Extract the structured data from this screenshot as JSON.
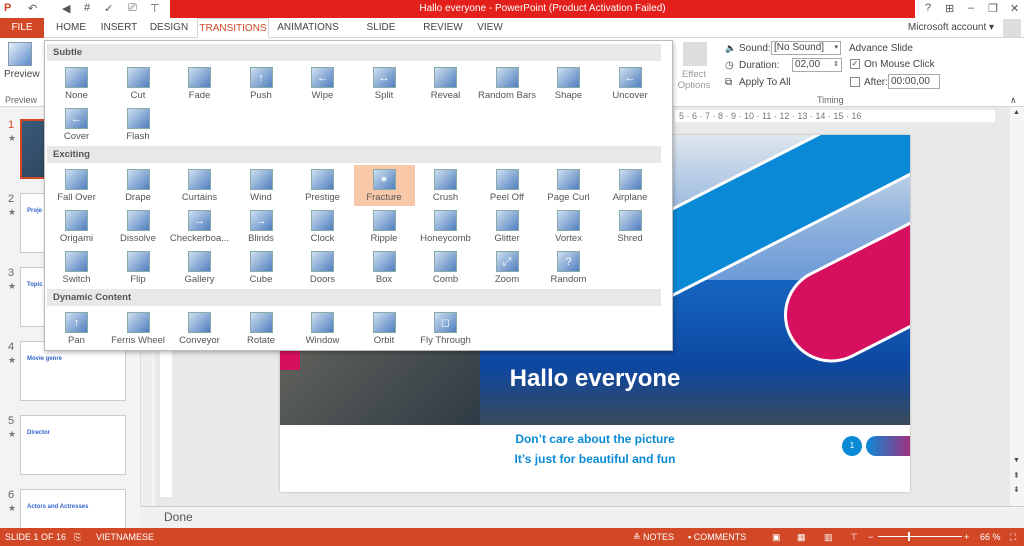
{
  "window": {
    "title": "Hallo everyone -  PowerPoint (Product Activation Failed)",
    "help": "?",
    "account": "Microsoft account"
  },
  "tabs": [
    "FILE",
    "HOME",
    "INSERT",
    "DESIGN",
    "TRANSITIONS",
    "ANIMATIONS",
    "SLIDE SHOW",
    "REVIEW",
    "VIEW"
  ],
  "ribbon": {
    "preview_label": "Preview",
    "preview_group": "Preview",
    "effect_options": "Effect Options",
    "sound_label": "Sound:",
    "sound_value": "[No Sound]",
    "duration_label": "Duration:",
    "duration_value": "02,00",
    "apply_all": "Apply To All",
    "advance_title": "Advance Slide",
    "on_click": "On Mouse Click",
    "on_click_checked": true,
    "after_label": "After:",
    "after_value": "00:00,00",
    "after_checked": false,
    "timing_group": "Timing"
  },
  "gallery": {
    "selected": "Fracture",
    "sections": [
      {
        "title": "Subtle",
        "items": [
          "None",
          "Cut",
          "Fade",
          "Push",
          "Wipe",
          "Split",
          "Reveal",
          "Random Bars",
          "Shape",
          "Uncover",
          "Cover",
          "Flash"
        ]
      },
      {
        "title": "Exciting",
        "items": [
          "Fall Over",
          "Drape",
          "Curtains",
          "Wind",
          "Prestige",
          "Fracture",
          "Crush",
          "Peel Off",
          "Page Curl",
          "Airplane",
          "Origami",
          "Dissolve",
          "Checkerboa...",
          "Blinds",
          "Clock",
          "Ripple",
          "Honeycomb",
          "Glitter",
          "Vortex",
          "Shred",
          "Switch",
          "Flip",
          "Gallery",
          "Cube",
          "Doors",
          "Box",
          "Comb",
          "Zoom",
          "Random"
        ]
      },
      {
        "title": "Dynamic Content",
        "items": [
          "Pan",
          "Ferris Wheel",
          "Conveyor",
          "Rotate",
          "Window",
          "Orbit",
          "Fly Through"
        ]
      }
    ]
  },
  "thumbnails": [
    {
      "n": "1",
      "star": "★",
      "label": ""
    },
    {
      "n": "2",
      "star": "★",
      "label": "Proje"
    },
    {
      "n": "3",
      "star": "★",
      "label": "Topic"
    },
    {
      "n": "4",
      "star": "★",
      "label": "Movie genre"
    },
    {
      "n": "5",
      "star": "★",
      "label": "Director"
    },
    {
      "n": "6",
      "star": "★",
      "label": "Actors and Actresses"
    }
  ],
  "ruler": "5 · 6 · 7 · 8 · 9 · 10 · 11 · 12 · 13 · 14 · 15 · 16",
  "slide": {
    "title": "Hallo everyone",
    "line1": "Don’t care about the picture",
    "line2": "It’s just for beautiful and fun",
    "page": "1"
  },
  "notes": "Done",
  "status": {
    "slide": "SLIDE 1 OF 16",
    "language": "VIETNAMESE",
    "notes": "NOTES",
    "comments": "COMMENTS",
    "zoom": "66 %"
  },
  "colors": {
    "accent": "#d24726",
    "titlebar": "#e3201b",
    "blue": "#0a8ad6",
    "pink": "#d6105e"
  }
}
